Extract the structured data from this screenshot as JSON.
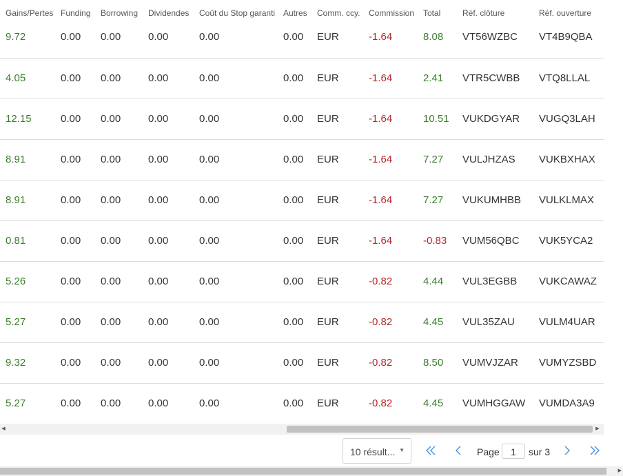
{
  "table": {
    "headers": [
      "Gains/Pertes",
      "Funding",
      "Borrowing",
      "Dividendes",
      "Coût du Stop garanti",
      "Autres",
      "Comm. ccy.",
      "Commission",
      "Total",
      "Réf. clôture",
      "Réf. ouverture"
    ],
    "rows": [
      [
        "9.72",
        "0.00",
        "0.00",
        "0.00",
        "0.00",
        "0.00",
        "EUR",
        "-1.64",
        "8.08",
        "VT56WZBC",
        "VT4B9QBA"
      ],
      [
        "4.05",
        "0.00",
        "0.00",
        "0.00",
        "0.00",
        "0.00",
        "EUR",
        "-1.64",
        "2.41",
        "VTR5CWBB",
        "VTQ8LLAL"
      ],
      [
        "12.15",
        "0.00",
        "0.00",
        "0.00",
        "0.00",
        "0.00",
        "EUR",
        "-1.64",
        "10.51",
        "VUKDGYAR",
        "VUGQ3LAH"
      ],
      [
        "8.91",
        "0.00",
        "0.00",
        "0.00",
        "0.00",
        "0.00",
        "EUR",
        "-1.64",
        "7.27",
        "VULJHZAS",
        "VUKBXHAX"
      ],
      [
        "8.91",
        "0.00",
        "0.00",
        "0.00",
        "0.00",
        "0.00",
        "EUR",
        "-1.64",
        "7.27",
        "VUKUMHBB",
        "VULKLMAX"
      ],
      [
        "0.81",
        "0.00",
        "0.00",
        "0.00",
        "0.00",
        "0.00",
        "EUR",
        "-1.64",
        "-0.83",
        "VUM56QBC",
        "VUK5YCA2"
      ],
      [
        "5.26",
        "0.00",
        "0.00",
        "0.00",
        "0.00",
        "0.00",
        "EUR",
        "-0.82",
        "4.44",
        "VUL3EGBB",
        "VUKCAWAZ"
      ],
      [
        "5.27",
        "0.00",
        "0.00",
        "0.00",
        "0.00",
        "0.00",
        "EUR",
        "-0.82",
        "4.45",
        "VUL35ZAU",
        "VULM4UAR"
      ],
      [
        "9.32",
        "0.00",
        "0.00",
        "0.00",
        "0.00",
        "0.00",
        "EUR",
        "-0.82",
        "8.50",
        "VUMVJZAR",
        "VUMYZSBD"
      ],
      [
        "5.27",
        "0.00",
        "0.00",
        "0.00",
        "0.00",
        "0.00",
        "EUR",
        "-0.82",
        "4.45",
        "VUMHGGAW",
        "VUMDA3A9"
      ]
    ]
  },
  "pagination": {
    "page_size_label": "10 résult...",
    "page_label": "Page",
    "current_page": "1",
    "total_label": "sur 3"
  },
  "colors": {
    "positive": "#3b7d2c",
    "negative": "#b8262a",
    "accent": "#4a90d9"
  },
  "icons": {
    "first": "double-chevron-left-icon",
    "prev": "chevron-left-icon",
    "next": "chevron-right-icon",
    "last": "double-chevron-right-icon"
  }
}
